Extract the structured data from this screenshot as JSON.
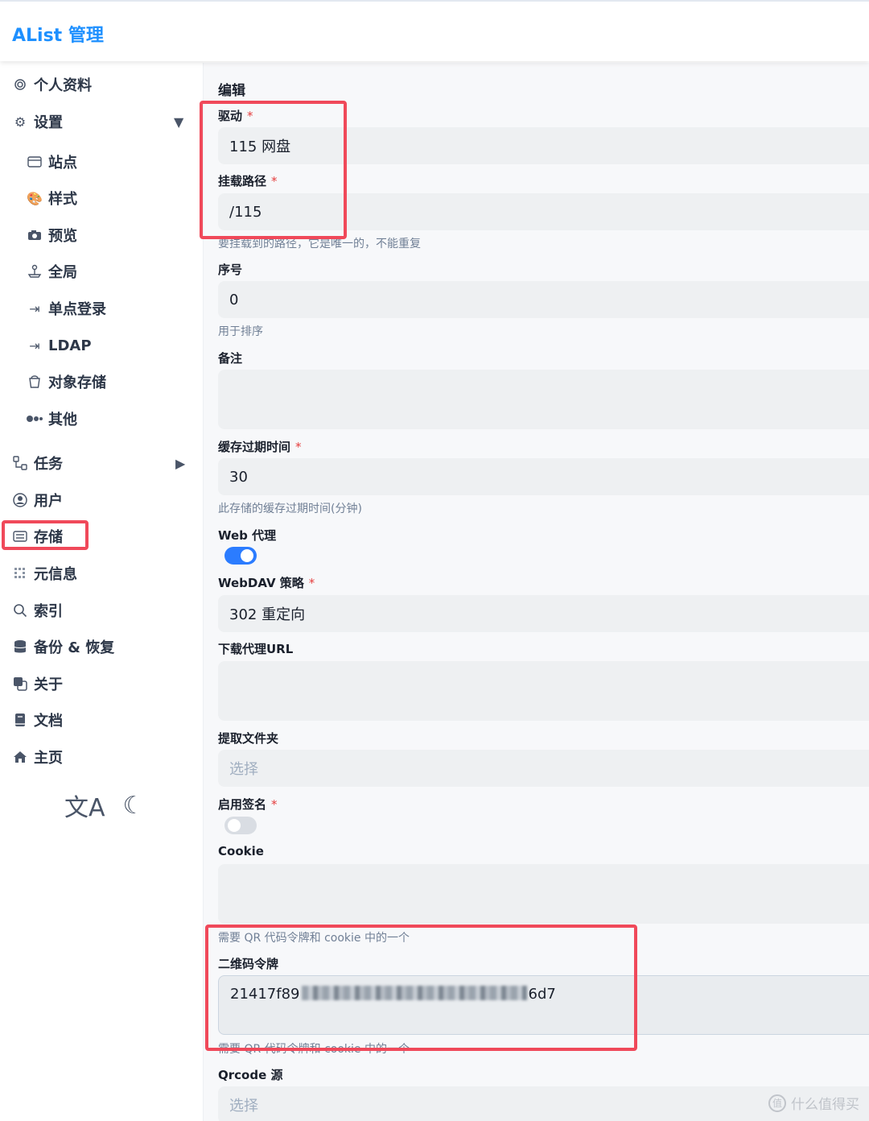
{
  "header": {
    "brand": "AList 管理"
  },
  "sidebar": {
    "profile": "个人资料",
    "settings": "设置",
    "sub_items": {
      "site": "站点",
      "style": "样式",
      "preview": "预览",
      "global": "全局",
      "sso": "单点登录",
      "ldap": "LDAP",
      "s3": "对象存储",
      "other": "其他"
    },
    "tasks": "任务",
    "users": "用户",
    "storages": "存储",
    "meta": "元信息",
    "index": "索引",
    "backup": "备份 & 恢复",
    "about": "关于",
    "docs": "文档",
    "home": "主页",
    "lang_glyph": "文A",
    "theme_glyph": "☾"
  },
  "form": {
    "title": "编辑",
    "required_mark": "*",
    "driver": {
      "label": "驱动",
      "value": "115 网盘"
    },
    "mount_path": {
      "label": "挂载路径",
      "value": "/115",
      "help": "要挂载到的路径，它是唯一的，不能重复"
    },
    "order": {
      "label": "序号",
      "value": "0",
      "help": "用于排序"
    },
    "remark": {
      "label": "备注",
      "value": ""
    },
    "cache": {
      "label": "缓存过期时间",
      "value": "30",
      "help": "此存储的缓存过期时间(分钟)"
    },
    "web_proxy": {
      "label": "Web 代理",
      "enabled": true
    },
    "webdav": {
      "label": "WebDAV 策略",
      "value": "302 重定向"
    },
    "down_proxy": {
      "label": "下载代理URL",
      "value": ""
    },
    "extract_folder": {
      "label": "提取文件夹",
      "placeholder": "选择"
    },
    "enable_sign": {
      "label": "启用签名",
      "enabled": false
    },
    "cookie": {
      "label": "Cookie",
      "value": "",
      "help": "需要 QR 代码令牌和 cookie 中的一个"
    },
    "qr_token": {
      "label": "二维码令牌",
      "value_prefix": "21417f89",
      "value_suffix": "6d7",
      "help": "需要 QR 代码令牌和 cookie 中的一个"
    },
    "qrcode_source": {
      "label": "Qrcode 源",
      "placeholder": "选择"
    }
  },
  "watermark": {
    "text": "什么值得买",
    "glyph": "值"
  },
  "colors": {
    "accent": "#1e90ff",
    "toggle_on": "#2b7cff",
    "highlight": "#f0495a"
  }
}
